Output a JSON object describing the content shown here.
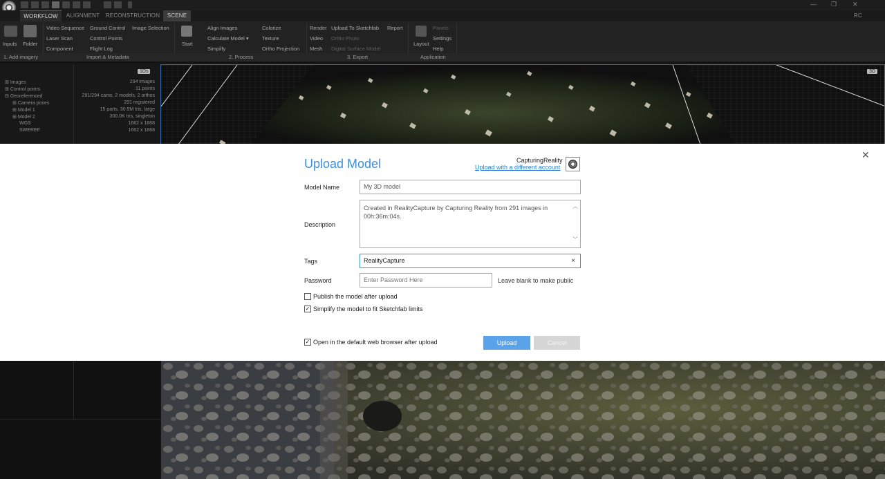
{
  "app": {
    "tabs": [
      {
        "label": "WORKFLOW"
      },
      {
        "label": "ALIGNMENT"
      },
      {
        "label": "RECONSTRUCTION"
      },
      {
        "label": "SCENE"
      }
    ],
    "user_initials": "RC"
  },
  "ribbon": {
    "inputs": "Inputs",
    "folder": "Folder",
    "video_sequence": "Video Sequence",
    "laser_scan": "Laser Scan",
    "component": "Component",
    "ground_control": "Ground Control",
    "control_points": "Control Points",
    "flight_log": "Flight Log",
    "image_selection": "Image Selection",
    "start": "Start",
    "align_images": "Align Images",
    "calculate_model": "Calculate Model ▾",
    "simplify": "Simplify",
    "colorize": "Colorize",
    "texture": "Texture",
    "ortho_projection": "Ortho Projection",
    "render": "Render",
    "video": "Video",
    "mesh": "Mesh",
    "upload_sketchfab": "Upload To Sketchfab",
    "ortho_photo": "Ortho Photo",
    "digital_surface_model": "Digital Surface Model",
    "report": "Report",
    "layout": "Layout",
    "panels": "Panels",
    "settings": "Settings",
    "help": "Help",
    "groups": {
      "add_imagery": "1. Add imagery",
      "import_metadata": "Import & Metadata",
      "process": "2. Process",
      "export": "3. Export",
      "application": "Application"
    }
  },
  "panel": {
    "badge": "1Ds",
    "rows": [
      {
        "name": "Images",
        "value": "294 images"
      },
      {
        "name": "Control points",
        "value": "11 points"
      },
      {
        "name": "Georeferenced",
        "value": "291/294 cams, 2 models, 2 orthos"
      },
      {
        "name": "Camera poses",
        "value": "291 registered"
      },
      {
        "name": "Model 1",
        "value": "15 parts, 30.9M tris, large"
      },
      {
        "name": "Model 2",
        "value": "300.0K tris, singleton"
      },
      {
        "name": "WGS",
        "value": "1662 x 1868"
      },
      {
        "name": "SWEREF",
        "value": "1662 x 1868"
      }
    ]
  },
  "viewport": {
    "badge": "3D"
  },
  "dialog": {
    "title": "Upload Model",
    "account_name": "CapturingReality",
    "account_link": "Upload with a different account",
    "model_name_label": "Model Name",
    "model_name_value": "My 3D model",
    "description_label": "Description",
    "description_value": "Created in RealityCapture by Capturing Reality from 291 images in 00h:36m:04s.",
    "tags_label": "Tags",
    "tags_value": "RealityCapture",
    "password_label": "Password",
    "password_placeholder": "Enter Password Here",
    "password_hint": "Leave blank to make public",
    "publish_label": "Publish the model after upload",
    "publish_checked": false,
    "simplify_label": "Simplify the model to fit Sketchfab limits",
    "simplify_checked": true,
    "open_browser_label": "Open in the default web browser after upload",
    "open_browser_checked": true,
    "upload_button": "Upload",
    "cancel_button": "Cancel"
  }
}
